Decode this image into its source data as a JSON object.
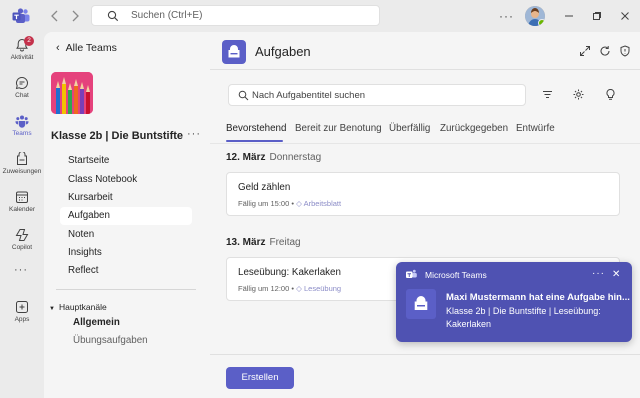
{
  "colors": {
    "brand": "#5b5fc7",
    "toast": "#4f52b2",
    "badge": "#c4314b",
    "presence": "#6bb700"
  },
  "titlebar": {
    "search_placeholder": "Suchen (Ctrl+E)",
    "more": "···",
    "icons": [
      "teams-logo-icon",
      "back-arrow-icon",
      "forward-arrow-icon",
      "search-icon",
      "minimize-icon",
      "maximize-icon",
      "close-icon"
    ]
  },
  "rail": {
    "items": [
      {
        "label": "Aktivität",
        "icon": "bell-icon",
        "badge": "2"
      },
      {
        "label": "Chat",
        "icon": "chat-icon"
      },
      {
        "label": "Teams",
        "icon": "teams-icon",
        "active": true
      },
      {
        "label": "Zuweisungen",
        "icon": "assignments-icon"
      },
      {
        "label": "Kalender",
        "icon": "calendar-icon"
      },
      {
        "label": "Copilot",
        "icon": "copilot-icon"
      },
      {
        "label": "Apps",
        "icon": "apps-icon"
      }
    ],
    "more": "···"
  },
  "left": {
    "back_label": "Alle Teams",
    "team_name": "Klasse 2b | Die Buntstifte",
    "team_more": "···",
    "channels": [
      "Startseite",
      "Class Notebook",
      "Kursarbeit",
      "Aufgaben",
      "Noten",
      "Insights",
      "Reflect"
    ],
    "active_channel": "Aufgaben",
    "section_title": "Hauptkanäle",
    "sub_channels": [
      "Allgemein",
      "Übungsaufgaben"
    ]
  },
  "main": {
    "title": "Aufgaben",
    "search_placeholder": "Nach Aufgabentitel suchen",
    "tabs": [
      "Bevorstehend",
      "Bereit zur Benotung",
      "Überfällig",
      "Zurückgegeben",
      "Entwürfe"
    ],
    "active_tab": "Bevorstehend",
    "groups": [
      {
        "date": "12. März",
        "weekday": "Donnerstag",
        "task": {
          "title": "Geld zählen",
          "due": "Fällig um 15:00",
          "sep": "•",
          "tag": "Arbeitsblatt"
        }
      },
      {
        "date": "13. März",
        "weekday": "Freitag",
        "task": {
          "title": "Leseübung: Kakerlaken",
          "due": "Fällig um 12:00",
          "sep": "•",
          "tag": "Leseübung"
        }
      }
    ],
    "create_label": "Erstellen"
  },
  "toast": {
    "app_name": "Microsoft Teams",
    "more": "···",
    "close": "✕",
    "heading": "Maxi Mustermann hat eine Aufgabe hin...",
    "body": "Klasse 2b | Die Buntstifte | Leseübung: Kakerlaken"
  }
}
